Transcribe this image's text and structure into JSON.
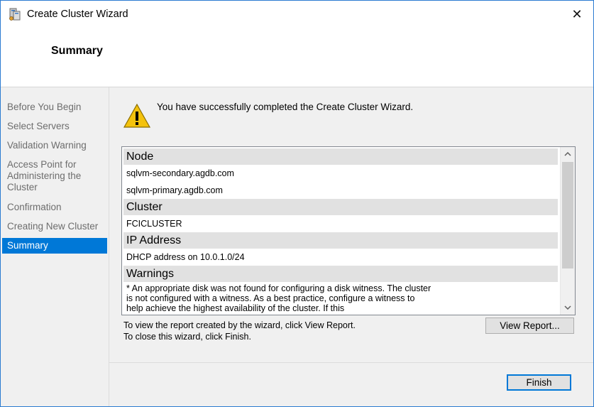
{
  "window": {
    "title": "Create Cluster Wizard",
    "close_glyph": "✕",
    "header_title": "Summary"
  },
  "nav": {
    "items": [
      {
        "label": "Before You Begin"
      },
      {
        "label": "Select Servers"
      },
      {
        "label": "Validation Warning"
      },
      {
        "label": "Access Point for Administering the Cluster"
      },
      {
        "label": "Confirmation"
      },
      {
        "label": "Creating New Cluster"
      },
      {
        "label": "Summary",
        "active": true
      }
    ]
  },
  "content": {
    "message": "You have successfully completed the Create Cluster Wizard.",
    "report": {
      "sections": [
        {
          "header": "Node",
          "rows": [
            "sqlvm-secondary.agdb.com",
            "sqlvm-primary.agdb.com"
          ]
        },
        {
          "header": "Cluster",
          "rows": [
            "FCICLUSTER"
          ]
        },
        {
          "header": "IP Address",
          "rows": [
            "DHCP address on 10.0.1.0/24"
          ]
        },
        {
          "header": "Warnings",
          "rows": [
            "* An appropriate disk was not found for configuring a disk witness. The cluster is not configured with a witness. As a best practice, configure a witness to help achieve the highest availability of the cluster. If this"
          ]
        }
      ]
    },
    "footer_line1": "To view the report created by the wizard, click View Report.",
    "footer_line2": "To close this wizard, click Finish.",
    "view_report_label": "View Report...",
    "finish_label": "Finish"
  },
  "colors": {
    "accent": "#0078d7",
    "nav_text": "#6d6d6d",
    "window_border": "#2b7bd1"
  },
  "icons": {
    "app": "cluster-manager-icon",
    "status": "warning-icon"
  }
}
